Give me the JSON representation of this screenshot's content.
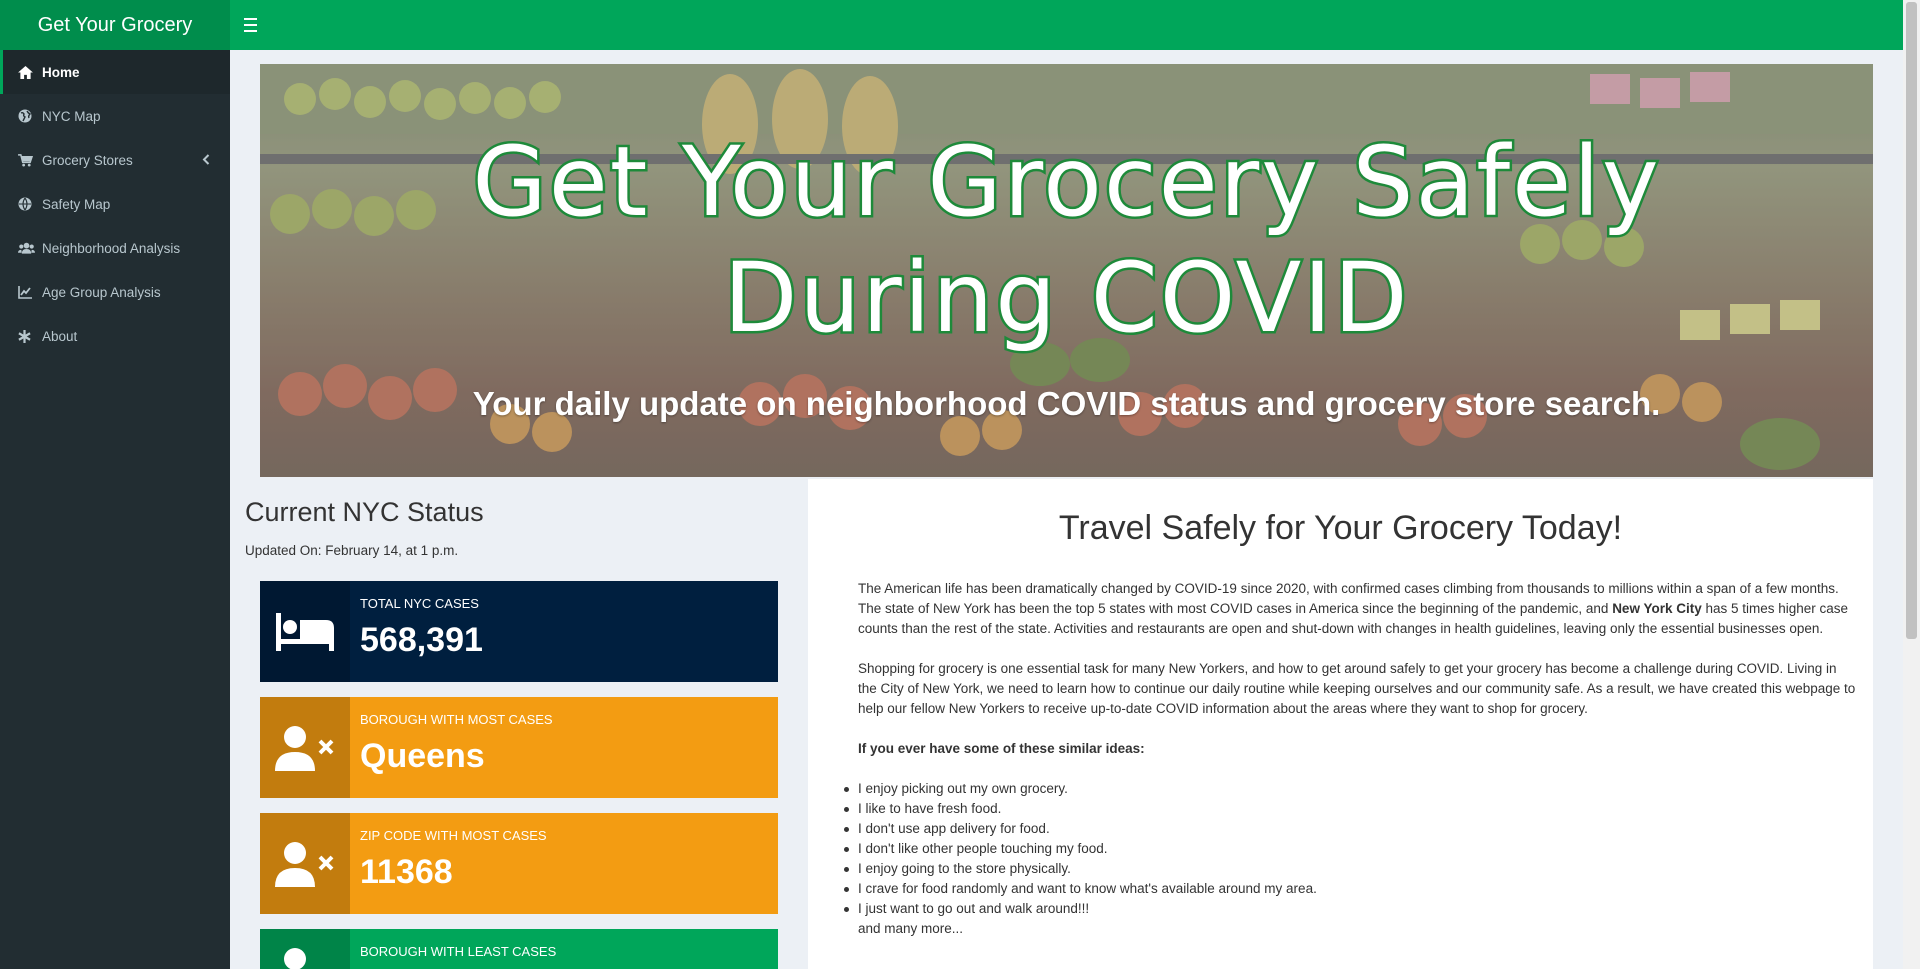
{
  "app": {
    "title": "Get Your Grocery"
  },
  "sidebar": {
    "items": [
      {
        "label": "Home",
        "icon": "home-icon",
        "active": true
      },
      {
        "label": "NYC Map",
        "icon": "globe-icon"
      },
      {
        "label": "Grocery Stores",
        "icon": "cart-icon",
        "has_submenu": true
      },
      {
        "label": "Safety Map",
        "icon": "globe-icon"
      },
      {
        "label": "Neighborhood Analysis",
        "icon": "users-icon"
      },
      {
        "label": "Age Group Analysis",
        "icon": "chart-icon"
      },
      {
        "label": "About",
        "icon": "asterisk-icon"
      }
    ]
  },
  "banner": {
    "title_line1": "Get Your Grocery Safely",
    "title_line2": "During COVID",
    "subtitle": "Your daily update on neighborhood COVID status and grocery store search."
  },
  "status": {
    "title": "Current NYC Status",
    "updated": "Updated On: February 14, at 1 p.m.",
    "boxes": [
      {
        "label": "TOTAL NYC CASES",
        "value": "568,391",
        "icon": "bed-icon",
        "color": "#001f3f"
      },
      {
        "label": "BOROUGH WITH MOST CASES",
        "value": "Queens",
        "icon": "user-times-icon",
        "color": "#f39c12"
      },
      {
        "label": "ZIP CODE WITH MOST CASES",
        "value": "11368",
        "icon": "user-times-icon",
        "color": "#f39c12"
      },
      {
        "label": "BOROUGH WITH LEAST CASES",
        "value": "",
        "icon": "user-check-icon",
        "color": "#00a65a"
      }
    ]
  },
  "panel": {
    "title": "Travel Safely for Your Grocery Today!",
    "p1_a": "The American life has been dramatically changed by COVID-19 since 2020, with confirmed cases climbing from thousands to millions within a span of a few months. The state of New York has been the top 5 states with most COVID cases in America since the beginning of the pandemic, and ",
    "p1_bold": "New York City",
    "p1_b": " has 5 times higher case counts than the rest of the state. Activities and restaurants are open and shut-down with changes in health guidelines, leaving only the essential businesses open.",
    "p2": "Shopping for grocery is one essential task for many New Yorkers, and how to get around safely to get your grocery has become a challenge during COVID. Living in the City of New York, we need to learn how to continue our daily routine while keeping ourselves and our community safe. As a result, we have created this webpage to help our fellow New Yorkers to receive up-to-date COVID information about the areas where they want to shop for grocery.",
    "ideas_heading": "If you ever have some of these similar ideas:",
    "ideas": [
      "I enjoy picking out my own grocery.",
      "I like to have fresh food.",
      "I don't use app delivery for food.",
      "I don't like other people touching my food.",
      "I enjoy going to the store physically.",
      "I crave for food randomly and want to know what's available around my area.",
      "I just want to go out and walk around!!!"
    ],
    "more": "and many more...",
    "teaser": ""
  },
  "colors": {
    "header": "#00a65a",
    "logo": "#008d4c",
    "sidebar": "#222d32"
  }
}
